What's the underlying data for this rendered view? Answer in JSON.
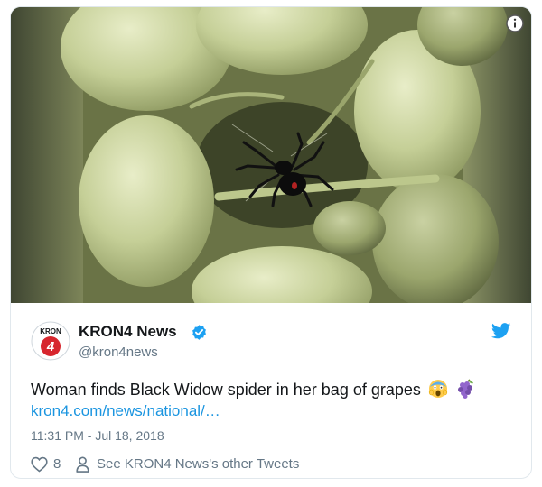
{
  "tweet": {
    "media": {
      "description_icon": "info-icon"
    },
    "author": {
      "display_name": "KRON4 News",
      "handle": "@kron4news",
      "avatar_text": "KRON",
      "avatar_number": "4",
      "verified_icon": "verified-badge-icon"
    },
    "brand_icon": "twitter-bird-icon",
    "text": "Woman finds Black Widow spider in her bag of grapes",
    "emojis": [
      "face-screaming-in-fear-emoji",
      "grapes-emoji"
    ],
    "link": "kron4.com/news/national/…",
    "timestamp": "11:31 PM - Jul 18, 2018",
    "like_count": "8",
    "other_tweets_label": "See KRON4 News's other Tweets"
  },
  "colors": {
    "link": "#1b95e0",
    "muted": "#657786",
    "twitter_blue": "#1da1f2",
    "avatar_red": "#d7262e"
  }
}
